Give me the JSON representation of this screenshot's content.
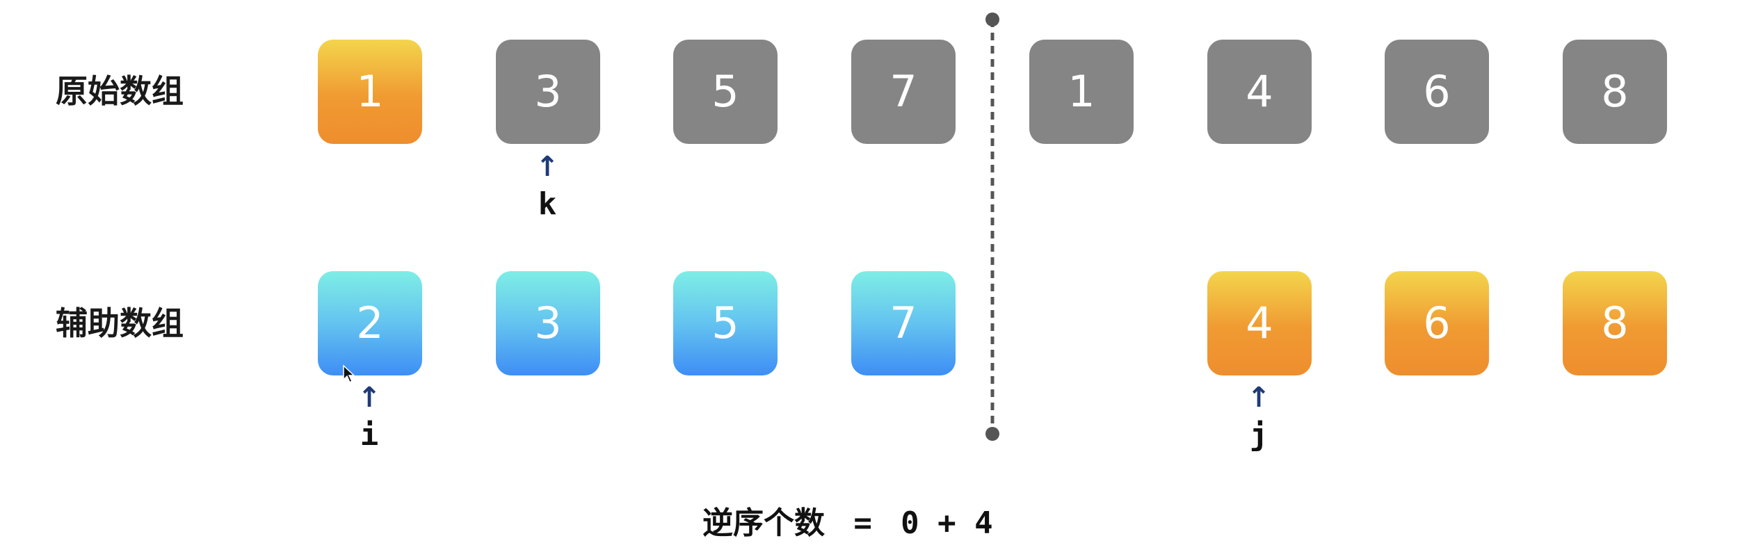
{
  "original_label": "原始数组",
  "aux_label": "辅助数组",
  "original_array": [
    {
      "value": "1",
      "color": "orange"
    },
    {
      "value": "3",
      "color": "gray"
    },
    {
      "value": "5",
      "color": "gray"
    },
    {
      "value": "7",
      "color": "gray"
    },
    {
      "value": "1",
      "color": "gray"
    },
    {
      "value": "4",
      "color": "gray"
    },
    {
      "value": "6",
      "color": "gray"
    },
    {
      "value": "8",
      "color": "gray"
    }
  ],
  "aux_array": [
    {
      "value": "2",
      "color": "blue"
    },
    {
      "value": "3",
      "color": "blue"
    },
    {
      "value": "5",
      "color": "blue"
    },
    {
      "value": "7",
      "color": "blue"
    },
    {
      "value": "",
      "color": "none"
    },
    {
      "value": "4",
      "color": "orange"
    },
    {
      "value": "6",
      "color": "orange"
    },
    {
      "value": "8",
      "color": "orange"
    }
  ],
  "pointers": {
    "k": {
      "label": "k",
      "row": "original",
      "index": 1
    },
    "i": {
      "label": "i",
      "row": "aux",
      "index": 0
    },
    "j": {
      "label": "j",
      "row": "aux",
      "index": 5
    }
  },
  "formula": {
    "label": "逆序个数",
    "equals": "=",
    "expr": "0 + 4"
  },
  "colors": {
    "gray": "#858585",
    "orange_top": "#f3d54c",
    "orange_bottom": "#ee8e2d",
    "blue_top": "#7eeee5",
    "blue_bottom": "#3e8ef5",
    "arrow": "#1e3a78",
    "divider": "#555555"
  }
}
